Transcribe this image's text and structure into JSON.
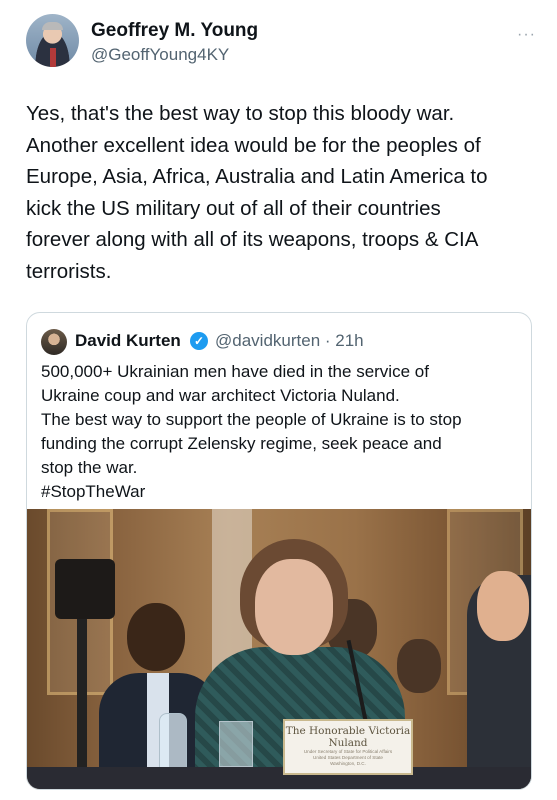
{
  "tweet": {
    "author_name": "Geoffrey M. Young",
    "author_handle": "@GeoffYoung4KY",
    "more_icon": "···",
    "text": "Yes, that's the best way to stop this bloody war.\nAnother excellent idea would be for the peoples of\nEurope, Asia, Africa, Australia and Latin America to\nkick the US military out of all of their countries\nforever along with all of its weapons, troops & CIA\nterrorists."
  },
  "quoted_tweet": {
    "author_name": "David Kurten",
    "verified_icon": "✓",
    "author_handle": "@davidkurten · 21h",
    "text": "500,000+ Ukrainian men have died in the service of\nUkraine coup and war architect Victoria Nuland.\nThe best way to support the people of Ukraine is to stop\nfunding the corrupt Zelensky regime, seek peace and\nstop the war.\n#StopTheWar",
    "image": {
      "nameplate_title": "The Honorable Victoria Nuland",
      "nameplate_lines": [
        "Under Secretary of State for Political Affairs",
        "United States Department of State",
        "Washington, D.C."
      ]
    }
  }
}
